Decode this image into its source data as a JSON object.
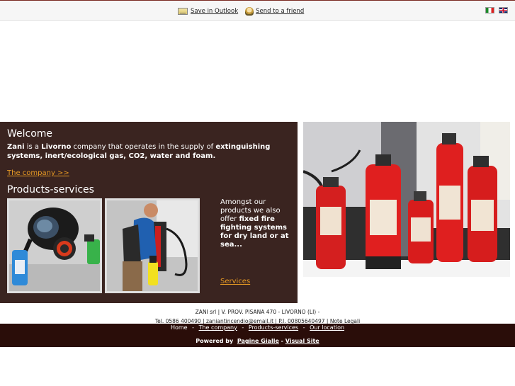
{
  "toplinks": {
    "save_outlook": "Save in Outlook",
    "send_friend": "Send to a friend",
    "outlook_icon": "outlook-icon",
    "send_icon": "send-friend-icon"
  },
  "languages": [
    {
      "code": "it",
      "label": "Italiano"
    },
    {
      "code": "en",
      "label": "English"
    }
  ],
  "welcome": {
    "title": "Welcome",
    "company": "Zani",
    "is_a": " is a ",
    "city": "Livorno",
    "mid": " company that operates in the supply of ",
    "highlight": "extinguishing systems, inert/ecological gas, CO2, water and foam.",
    "link": "The company >>"
  },
  "products": {
    "title": "Products-services",
    "promo_pre": "Amongst our products we also offer ",
    "promo_bold": "fixed fire fighting systems for dry land or at sea...",
    "services_link": "Services"
  },
  "footer": {
    "line1": "ZANI srl | V. PROV. PISANA 470 - LIVORNO (LI) -",
    "tel": "Tel. 0586 400490",
    "sep1": " | ",
    "email": "zaniantincendio@email.it",
    "sep2": " | P.I. 00805640497 | ",
    "legal": "Note Legali"
  },
  "nav": {
    "home": "Home",
    "company": "The company",
    "products": "Products-services",
    "location": "Our location",
    "separator": "-"
  },
  "powered": {
    "label": "Powered by",
    "pagine": "Pagine Gialle",
    "dash": "-",
    "visual": "Visual Site"
  },
  "colors": {
    "panel_bg": "#3a2420",
    "link_orange": "#e79a24",
    "navbar_bg": "#2a0d09"
  }
}
